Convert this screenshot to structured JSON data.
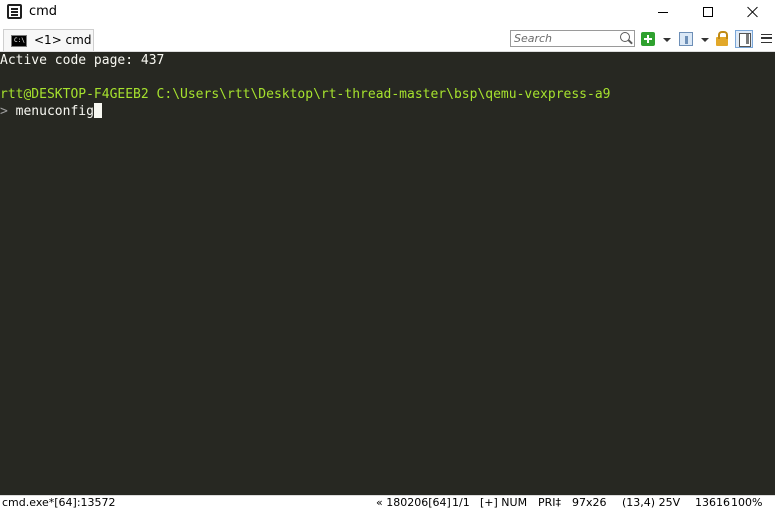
{
  "window": {
    "title": "cmd"
  },
  "tab": {
    "label": "<1> cmd",
    "icon_text": "C:\\"
  },
  "toolbar": {
    "search_placeholder": "Search"
  },
  "console": {
    "line1": "Active code page: 437",
    "prompt_user": "rtt@DESKTOP-F4GEEB2",
    "prompt_path": "C:\\Users\\rtt\\Desktop\\rt-thread-master\\bsp\\qemu-vexpress-a9",
    "prompt_symbol": ">",
    "command": "menuconfig"
  },
  "status": {
    "process": "cmd.exe*[64]:13572",
    "build": "« 180206[64]",
    "pages": "1/1",
    "keys": "[+] NUM",
    "priority": "PRI‡",
    "size": "97x26",
    "cursor_pos": "(13,4) 25V",
    "pid": "13616",
    "zoom": "100%"
  },
  "colors": {
    "console_bg": "#272822",
    "console_fg": "#f8f8f2",
    "prompt_green": "#a6e22e"
  }
}
